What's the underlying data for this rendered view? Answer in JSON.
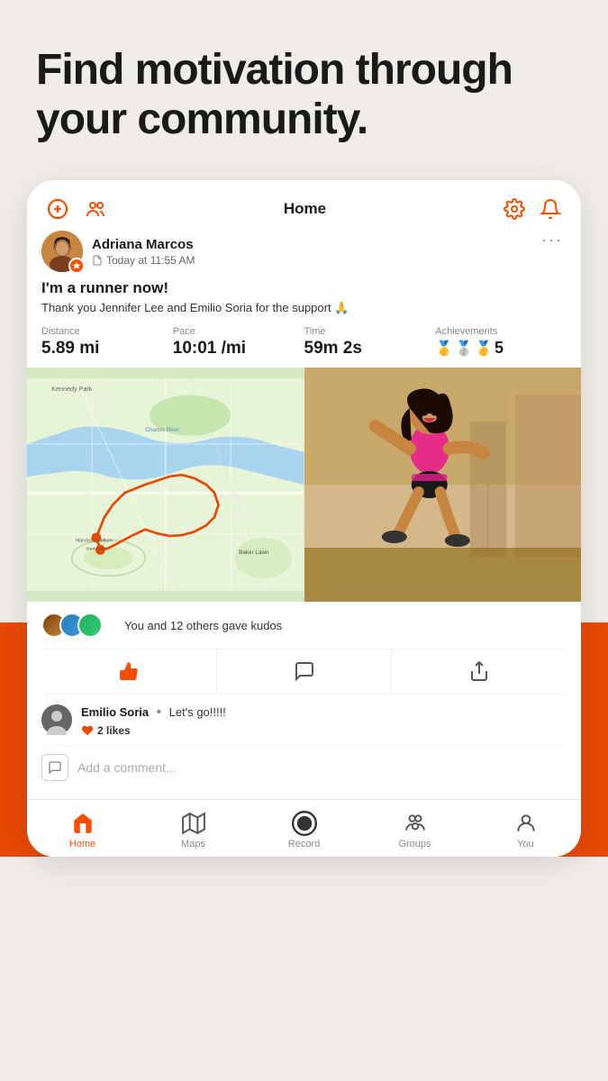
{
  "hero": {
    "title": "Find motivation through your community."
  },
  "card": {
    "header": {
      "title": "Home"
    },
    "post": {
      "user_name": "Adriana Marcos",
      "post_time": "Today at 11:55 AM",
      "caption_main": "I'm a runner now!",
      "caption_sub": "Thank you Jennifer Lee and Emilio Soria for the support 🙏",
      "stats": {
        "distance_label": "Distance",
        "distance_value": "5.89 mi",
        "pace_label": "Pace",
        "pace_value": "10:01 /mi",
        "time_label": "Time",
        "time_value": "59m 2s",
        "achievements_label": "Achievements",
        "achievements_value": "5"
      }
    },
    "kudos": {
      "text": "You and 12 others gave kudos"
    },
    "comment": {
      "user": "Emilio Soria",
      "separator": "•",
      "text": "Let's go!!!!!",
      "likes_count": "2 likes"
    },
    "add_comment_placeholder": "Add a comment..."
  },
  "bottom_nav": {
    "items": [
      {
        "id": "home",
        "label": "Home",
        "active": true
      },
      {
        "id": "maps",
        "label": "Maps",
        "active": false
      },
      {
        "id": "record",
        "label": "Record",
        "active": false
      },
      {
        "id": "groups",
        "label": "Groups",
        "active": false
      },
      {
        "id": "you",
        "label": "You",
        "active": false
      }
    ]
  },
  "icons": {
    "orange_color": "#fc4c02",
    "inactive_color": "#555555"
  }
}
